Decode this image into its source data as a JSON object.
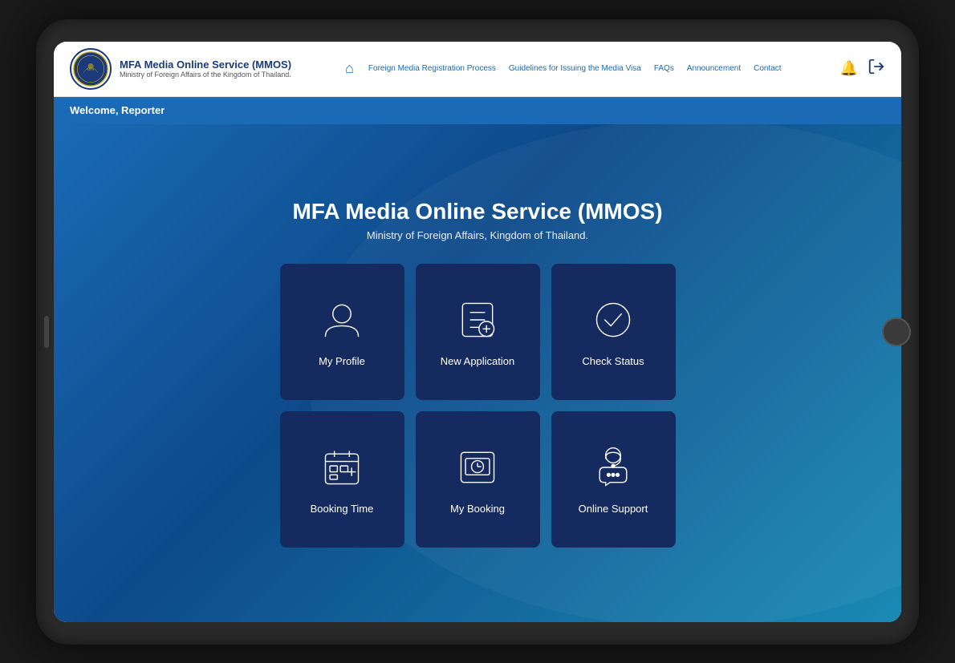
{
  "header": {
    "logo_alt": "Thailand MFA Logo",
    "title_main": "MFA Media Online Service (MMOS)",
    "title_sub": "Ministry of Foreign Affairs of the Kingdom of Thailand.",
    "nav": {
      "home_label": "Home",
      "links": [
        "Foreign Media Registration Process",
        "Guidelines for Issuing the Media Visa",
        "FAQs",
        "Announcement",
        "Contact"
      ]
    },
    "notification_icon": "🔔",
    "logout_icon": "⬚"
  },
  "welcome_bar": {
    "text": "Welcome, Reporter"
  },
  "main": {
    "title": "MFA Media Online Service (MMOS)",
    "subtitle": "Ministry of Foreign Affairs, Kingdom of Thailand.",
    "cards": [
      {
        "id": "my-profile",
        "label": "My Profile"
      },
      {
        "id": "new-application",
        "label": "New Application"
      },
      {
        "id": "check-status",
        "label": "Check Status"
      },
      {
        "id": "booking-time",
        "label": "Booking Time"
      },
      {
        "id": "my-booking",
        "label": "My Booking"
      },
      {
        "id": "online-support",
        "label": "Online Support"
      }
    ]
  }
}
